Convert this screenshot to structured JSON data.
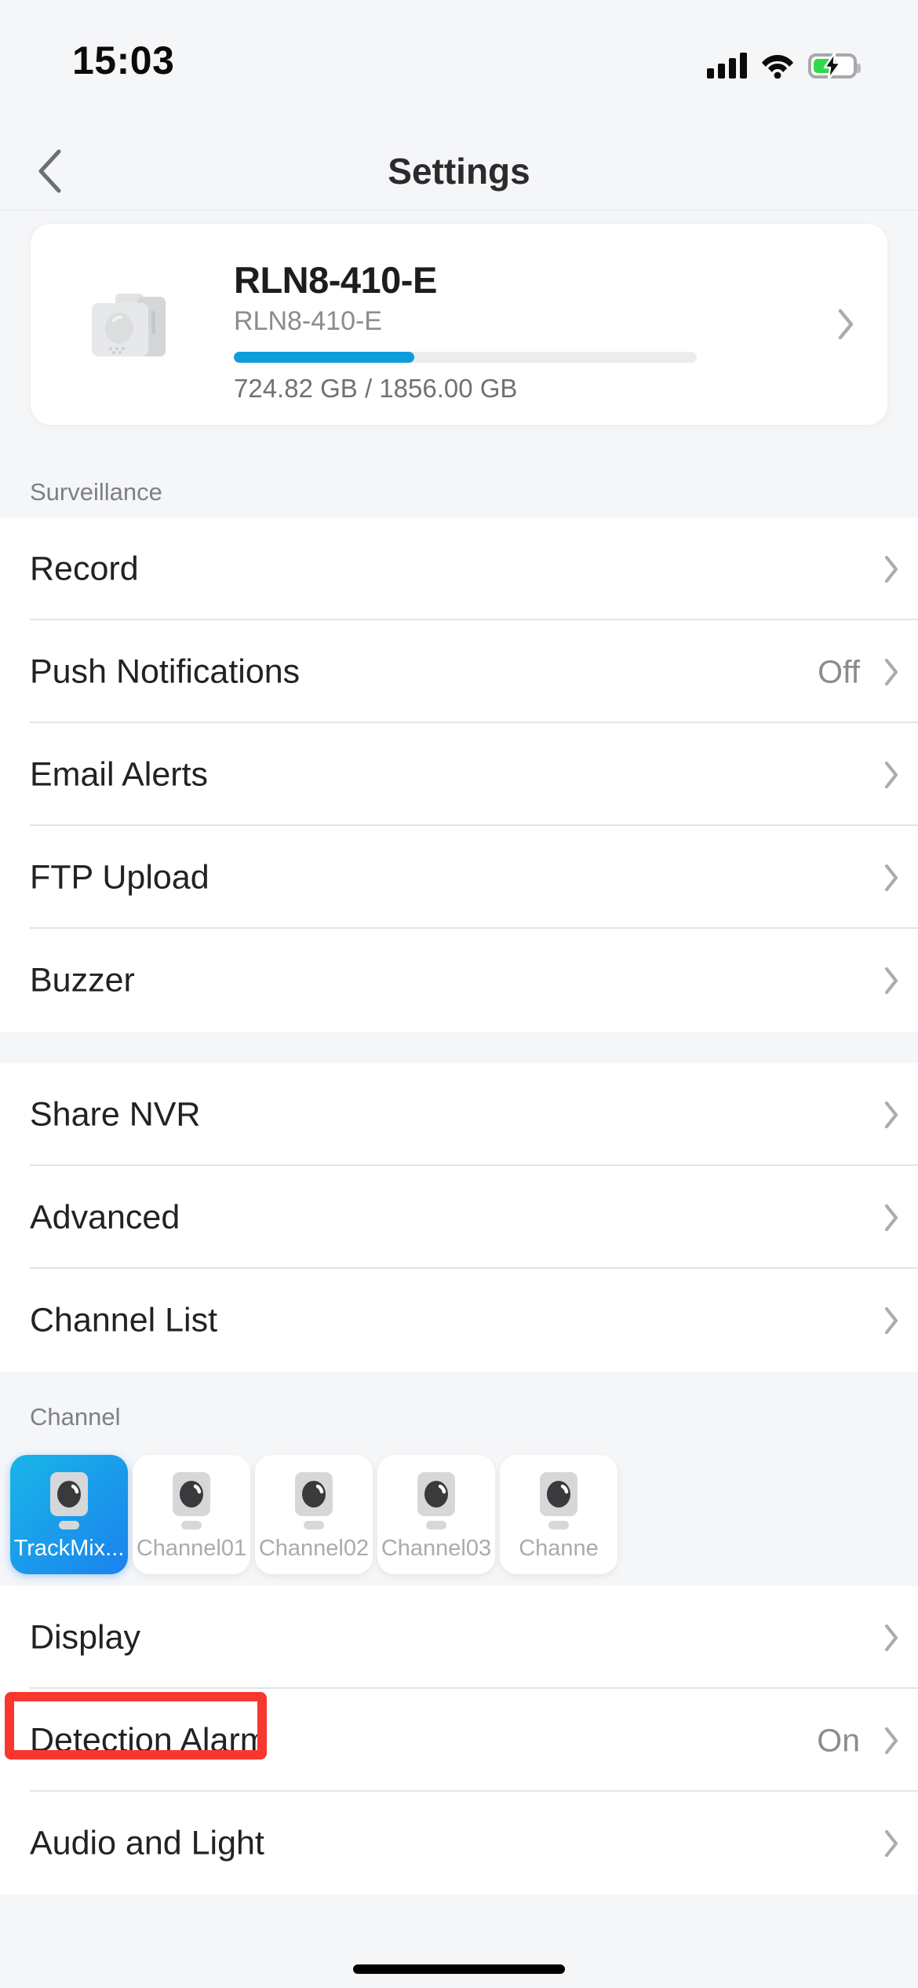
{
  "status_bar": {
    "time": "15:03",
    "signal_icon": "cellular-signal-icon",
    "wifi_icon": "wifi-icon",
    "battery_icon": "battery-charging-icon",
    "battery_level_pct": 54
  },
  "nav": {
    "back_icon": "chevron-left-icon",
    "title": "Settings"
  },
  "device_card": {
    "thumb_icon": "nvr-device-icon",
    "name": "RLN8-410-E",
    "model": "RLN8-410-E",
    "storage_text": "724.82 GB / 1856.00 GB",
    "storage_used_gb": 724.82,
    "storage_total_gb": 1856.0,
    "storage_fill_pct": 39,
    "chevron_icon": "chevron-right-icon",
    "accent_color": "#0e9ddb"
  },
  "sections": [
    {
      "header": "Surveillance",
      "rows": [
        {
          "label": "Record",
          "value": "",
          "chevron_icon": "chevron-right-icon"
        },
        {
          "label": "Push Notifications",
          "value": "Off",
          "chevron_icon": "chevron-right-icon"
        },
        {
          "label": "Email Alerts",
          "value": "",
          "chevron_icon": "chevron-right-icon"
        },
        {
          "label": "FTP Upload",
          "value": "",
          "chevron_icon": "chevron-right-icon"
        },
        {
          "label": "Buzzer",
          "value": "",
          "chevron_icon": "chevron-right-icon"
        }
      ]
    },
    {
      "header": "",
      "rows": [
        {
          "label": "Share NVR",
          "value": "",
          "chevron_icon": "chevron-right-icon"
        },
        {
          "label": "Advanced",
          "value": "",
          "chevron_icon": "chevron-right-icon"
        },
        {
          "label": "Channel List",
          "value": "",
          "chevron_icon": "chevron-right-icon"
        }
      ]
    }
  ],
  "channel_section": {
    "header": "Channel",
    "channels": [
      {
        "label": "TrackMix...",
        "selected": true,
        "icon": "camera-icon"
      },
      {
        "label": "Channel01",
        "selected": false,
        "icon": "camera-icon"
      },
      {
        "label": "Channel02",
        "selected": false,
        "icon": "camera-icon"
      },
      {
        "label": "Channel03",
        "selected": false,
        "icon": "camera-icon"
      },
      {
        "label": "Channe",
        "selected": false,
        "icon": "camera-icon"
      }
    ],
    "selected_gradient_from": "#19b6e8",
    "selected_gradient_to": "#1a82ee"
  },
  "channel_rows": [
    {
      "label": "Display",
      "value": "",
      "chevron_icon": "chevron-right-icon"
    },
    {
      "label": "Detection Alarm",
      "value": "On",
      "chevron_icon": "chevron-right-icon"
    },
    {
      "label": "Audio and Light",
      "value": "",
      "chevron_icon": "chevron-right-icon"
    }
  ],
  "highlight": {
    "target_label": "Detection Alarm",
    "color": "#f8372f"
  },
  "home_indicator": "home-indicator"
}
